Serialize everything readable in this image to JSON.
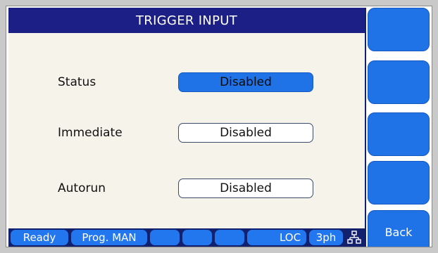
{
  "title": "TRIGGER INPUT",
  "settings": [
    {
      "label": "Status",
      "value": "Disabled",
      "selected": true
    },
    {
      "label": "Immediate",
      "value": "Disabled",
      "selected": false
    },
    {
      "label": "Autorun",
      "value": "Disabled",
      "selected": false
    }
  ],
  "status_bar": {
    "ready": "Ready",
    "prog": "Prog. MAN",
    "empty_1": "",
    "empty_2": "",
    "empty_3": "",
    "loc": "LOC",
    "phase": "3ph",
    "network_icon": "network-icon"
  },
  "softkeys": {
    "key_1": "",
    "key_2": "",
    "key_3": "",
    "key_4": "",
    "back": "Back"
  },
  "colors": {
    "title_bar": "#1b1f86",
    "accent_blue": "#1f73e6",
    "panel_background": "#f6f4ea",
    "status_bar": "#12206e"
  }
}
